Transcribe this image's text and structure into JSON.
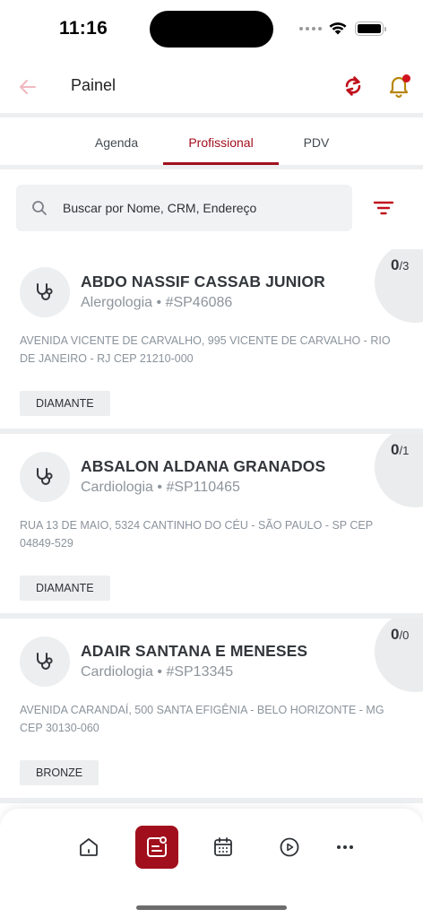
{
  "status_bar": {
    "time": "11:16"
  },
  "header": {
    "title": "Painel",
    "back_icon": "arrow-left-icon",
    "sync_icon": "sync-icon",
    "bell_icon": "bell-icon"
  },
  "tabs": [
    {
      "label": "Agenda",
      "active": false
    },
    {
      "label": "Profissional",
      "active": true
    },
    {
      "label": "PDV",
      "active": false
    }
  ],
  "search": {
    "placeholder": "Buscar por Nome, CRM, Endereço",
    "value": ""
  },
  "professionals": [
    {
      "name": "ABDO NASSIF CASSAB JUNIOR",
      "specialty": "Alergologia",
      "crm": "#SP46086",
      "address": "AVENIDA VICENTE DE CARVALHO, 995  VICENTE DE CARVALHO - RIO DE JANEIRO - RJ CEP 21210-000",
      "tag": "DIAMANTE",
      "count": "0",
      "total": "/3"
    },
    {
      "name": "ABSALON ALDANA GRANADOS",
      "specialty": "Cardiologia",
      "crm": "#SP110465",
      "address": "RUA 13 DE MAIO, 5324  CANTINHO DO CÉU - SÃO PAULO - SP CEP 04849-529",
      "tag": "DIAMANTE",
      "count": "0",
      "total": "/1"
    },
    {
      "name": "ADAIR SANTANA E MENESES",
      "specialty": "Cardiologia",
      "crm": "#SP13345",
      "address": "AVENIDA CARANDAÍ, 500  SANTA EFIGÊNIA - BELO HORIZONTE - MG CEP 30130-060",
      "tag": "BRONZE",
      "count": "0",
      "total": "/0"
    }
  ],
  "bottom_nav": [
    {
      "icon": "home-icon",
      "active": false
    },
    {
      "icon": "professional-card-icon",
      "active": true
    },
    {
      "icon": "calendar-icon",
      "active": false
    },
    {
      "icon": "play-icon",
      "active": false
    },
    {
      "icon": "more-icon",
      "active": false
    }
  ],
  "colors": {
    "accent": "#a10f1c",
    "bell_accent": "#b8860b",
    "badge_dot": "#d0121e",
    "card_bg": "#eceeef"
  }
}
